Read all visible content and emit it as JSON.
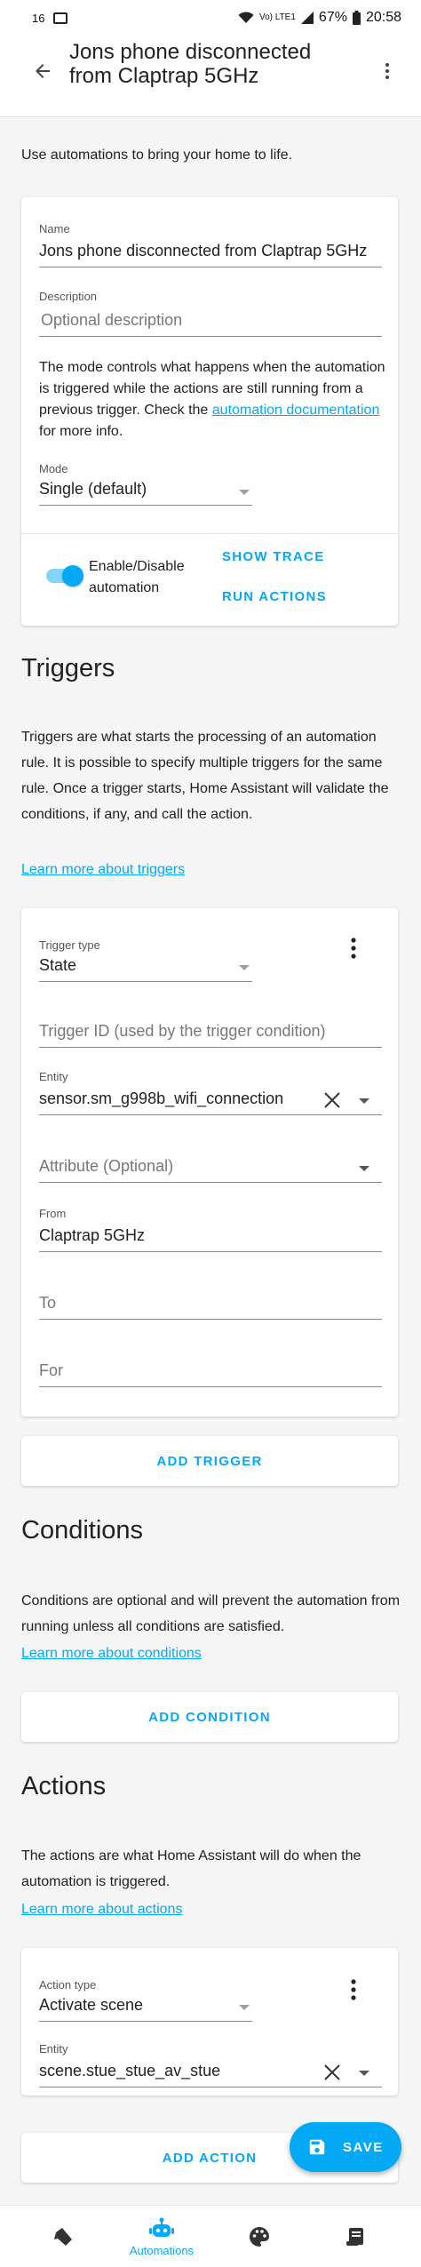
{
  "status_bar": {
    "left_text": "16",
    "battery_percent": "67%",
    "time": "20:58",
    "network": "Vo) LTE1"
  },
  "app_bar": {
    "title_line1": "Jons phone disconnected",
    "title_line2": "from Claptrap 5GHz"
  },
  "intro": "Use automations to bring your home to life.",
  "details_card": {
    "name_label": "Name",
    "name_value": "Jons phone disconnected from Claptrap 5GHz",
    "description_label": "Description",
    "description_placeholder": "Optional description",
    "mode_text_1": "The mode controls what happens when the automation is triggered while the actions are still running from a previous trigger. Check the",
    "mode_link": "automation documentation",
    "mode_text_2": "for more info.",
    "mode_label": "Mode",
    "mode_value": "Single (default)",
    "toggle_label": "Enable/Disable automation",
    "toggle_on": true,
    "show_trace": "SHOW TRACE",
    "run_actions": "RUN ACTIONS"
  },
  "triggers": {
    "title": "Triggers",
    "description": "Triggers are what starts the processing of an automation rule. It is possible to specify multiple triggers for the same rule. Once a trigger starts, Home Assistant will validate the conditions, if any, and call the action.",
    "learn_more": "Learn more about triggers",
    "card": {
      "trigger_type_label": "Trigger type",
      "trigger_type_value": "State",
      "trigger_id_placeholder": "Trigger ID (used by the trigger condition)",
      "entity_label": "Entity",
      "entity_value": "sensor.sm_g998b_wifi_connection",
      "attribute_placeholder": "Attribute (Optional)",
      "from_label": "From",
      "from_value": "Claptrap 5GHz",
      "to_placeholder": "To",
      "for_placeholder": "For"
    },
    "add_button": "ADD TRIGGER"
  },
  "conditions": {
    "title": "Conditions",
    "description": "Conditions are optional and will prevent the automation from running unless all conditions are satisfied.",
    "learn_more": "Learn more about conditions",
    "add_button": "ADD CONDITION"
  },
  "actions": {
    "title": "Actions",
    "description": "The actions are what Home Assistant will do when the automation is triggered.",
    "learn_more": "Learn more about actions",
    "card": {
      "action_type_label": "Action type",
      "action_type_value": "Activate scene",
      "entity_label": "Entity",
      "entity_value": "scene.stue_stue_av_stue"
    },
    "add_button": "ADD ACTION"
  },
  "fab": {
    "label": "SAVE"
  },
  "bottom_nav": {
    "items": [
      {
        "icon": "tag-icon"
      },
      {
        "icon": "robot-icon",
        "label": "Automations",
        "active": true
      },
      {
        "icon": "palette-icon"
      },
      {
        "icon": "script-icon"
      }
    ]
  },
  "colors": {
    "accent": "#03a9f4",
    "background": "#f5f5f5",
    "card": "#ffffff"
  }
}
